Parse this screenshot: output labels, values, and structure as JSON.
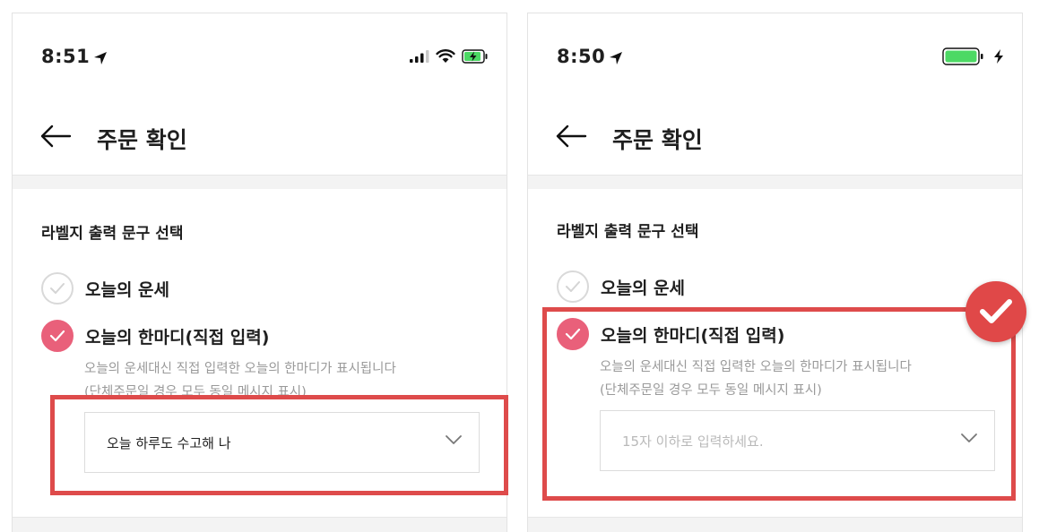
{
  "left_screen": {
    "status_time": "8:51",
    "header_title": "주문 확인",
    "section_title": "라벨지 출력 문구 선택",
    "options": [
      {
        "label": "오늘의 운세",
        "selected": false
      },
      {
        "label": "오늘의 한마디(직접 입력)",
        "selected": true
      }
    ],
    "description_line1": "오늘의 운세대신 직접 입력한 오늘의 한마디가 표시됩니다",
    "description_line2": "(단체주문일 경우 모두 동일 메시지 표시)",
    "input_value": "오늘 하루도 수고해 나"
  },
  "right_screen": {
    "status_time": "8:50",
    "header_title": "주문 확인",
    "section_title": "라벨지 출력 문구 선택",
    "options": [
      {
        "label": "오늘의 운세",
        "selected": false
      },
      {
        "label": "오늘의 한마디(직접 입력)",
        "selected": true
      }
    ],
    "description_line1": "오늘의 운세대신 직접 입력한 오늘의 한마디가 표시됩니다",
    "description_line2": "(단체주문일 경우 모두 동일 메시지 표시)",
    "input_placeholder": "15자 이하로 입력하세요."
  },
  "icons": {
    "location": "location-arrow-icon",
    "signal": "signal-bars-icon",
    "wifi": "wifi-icon",
    "battery": "battery-charging-icon",
    "back": "back-arrow-icon",
    "check": "check-icon",
    "chevron": "chevron-down-icon"
  },
  "colors": {
    "accent_pink": "#e9607a",
    "highlight_red": "#de4b4b",
    "battery_green": "#4cd964"
  }
}
